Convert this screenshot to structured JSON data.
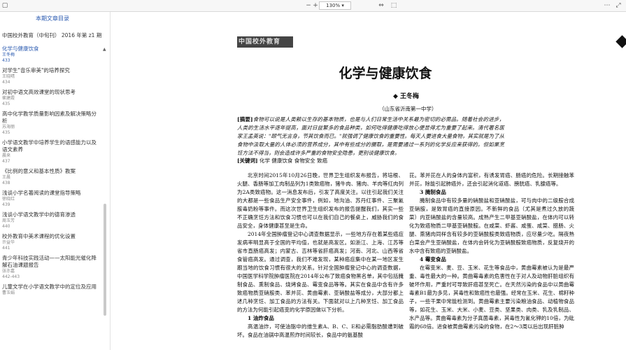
{
  "toolbar": {
    "zoom": "130%",
    "icons": [
      "page-icon",
      "close-x-icon",
      "zoom-out-icon",
      "zoom-in-icon",
      "zoom-dropdown-icon",
      "fit-width-icon",
      "fit-page-icon",
      "more-icon"
    ]
  },
  "sidebar": {
    "title": "本期文章目录",
    "journal": "中国校外教育（中旬刊）  2016 年第 z1 期",
    "items": [
      {
        "title": "化学与健康饮食",
        "author": "王冬梅",
        "page": "433",
        "active": true
      },
      {
        "title": "对学生\"音乐审美\"的培养探究",
        "author": "王晓晴",
        "page": "434"
      },
      {
        "title": "对初中语文高效课堂的现状思考",
        "author": "崔建霞",
        "page": "435"
      },
      {
        "title": "高中化学教学质量影响因素及解决策略分析",
        "author": "苏海丽",
        "page": "435"
      },
      {
        "title": "小学语文教学中培养学生的语感能力以及语文素养",
        "author": "晨来",
        "page": "437"
      },
      {
        "title": "《比例的意义和基本性质》教案",
        "author": "王晨",
        "page": "438"
      },
      {
        "title": "浅谈小学名著阅读的课堂指导策略",
        "author": "徐晓红",
        "page": "439"
      },
      {
        "title": "浅谈小学语文教学中的德育渗透",
        "author": "周玉芳",
        "page": "440"
      },
      {
        "title": "校外教育中美术课程的优化设置",
        "author": "许益华",
        "page": "441"
      },
      {
        "title": "青少年科技实践活动——太阳能光催化降解石油课题报告",
        "author": "张亦嘉",
        "page": "442-443"
      },
      {
        "title": "儿童文学在小学语文教学中的定位及应用",
        "author": "曹玉娟",
        "page": ""
      }
    ]
  },
  "doc": {
    "masthead": "中国校外教育",
    "headline": "化学与健康饮食",
    "author": "◆ 王冬梅",
    "affiliation": "（山东省沂南第一中学）",
    "abstract_label": "[摘要]",
    "abstract": "食物可以说是人类赖以生存的基本物质，也是与人们日常生活中关系最为密切的必需品。随着社会的进步，人类的生活水平逐年提高，面对日益繁多的食品种类，如何吃得健康吃得放心便显得尤为重要了起来。清代著名医家王孟英说：\"颐气无言身，节其饮食而已。\"就强调了健康饮食的重要性。每天人要进食大量食物，其实就是为了从食物中汲取大量的人体必须的营养成分，其中有些成分的摄取，是需要通过一系列的化学反应来获得的。但如果烹饪方法不得当，则会造成许多严重的食物安全隐患，更别谈健康饮食。",
    "keywords_label": "[关键词]",
    "keywords": "化学   健康饮食   食物安全   致癌",
    "col1": [
      {
        "type": "p",
        "text": "北京时间2015年10月26日晚，世界卫生组织发布报告，将培根、火腿、香肠等加工肉制品列为1类致癌物，猪牛肉、猪肉、羊肉等红肉列为2A类致癌物。这一消息发布后，引发了高度关注。以往引起我们关注的大都是一些食品生产安全事件，例如，地沟油、苏丹红事件、三聚氰胺毒奶粉等事件。而这次世界卫生组织发布的报告提醒我们，其实一些不正确烹饪方法和饮食习惯也可以在我们自己的餐桌上，威胁我们的食品安全，身体健康甚至是生命。"
      },
      {
        "type": "p",
        "text": "2014年全国肿瘤登记中心调查数据显示，一些地方存在着某些癌症发病率明显高于全国的平均值，也就是高发区。如浙江、上海、江苏等省市直肠癌高发；内蒙古、吉林等省肝癌高发；河南、河北、山西等省食管癌高发。通过调查，我们不难发现，某种癌症集中在某一地区发生跟当地的饮食习惯有很大的关系。针对全国肿瘤登记中心的调查数据，中国医学科学院肿瘤医院在2014年公布了致癌食物黑名单，其中包括腌制食品、熏制食品、烧烤食品、霉变食品等等。其实在食品中含有许多致癌物质亚硝胺类、苯并芘、黄曲霉素、亚硝酸盐等成分，大部分都上述几种烹饪、加工食品的方法有关。下面就对以上几种烹饪、加工食品的方法为何能引起癌变的化学原因做以下分析。"
      },
      {
        "type": "h",
        "text": "1 油炸食品"
      },
      {
        "type": "p",
        "text": "高温油炸，可使油脂中的维生素A、B、C、E和必需脂肪酸遭到破坏。食品在油锅中高温煎炸时间较长，食品中的氨基酸"
      }
    ],
    "col2": [
      {
        "type": "n",
        "text": "芘。苯并芘在人的身体内富积，有诱发胃癌、肠癌的危险。长期接触苯并芘，除能引起肺癌外，还会引起消化道癌、膀胱癌、乳腺癌等。"
      },
      {
        "type": "h",
        "text": "3 腌制食品"
      },
      {
        "type": "p",
        "text": "腌制食品中有较多量的硝酸盐和亚硝酸盐，可与肉中的二级胺合成亚硝胺，是致胃癌的直接原因。不新鲜的食品（尤其是煮过久放的蔬菜）内亚硝酸盐的含量较高。成熟产生二甲基亚硝酸盐，在体内可以转化为致癌物质二甲基亚硝酸胺。在咸菜、虾酱、咸蛋、咸菜、腊肠、火腿、熏猪肉同样含有较多的亚硝酸胺类致癌物质，应尽量少吃。隔夜熟白菜会产生亚硝酸盐，在体内会转化为亚硝酸胺致癌物质，反复烧开的水中含有致癌的亚硝酸盐。"
      },
      {
        "type": "h",
        "text": "4 霉变食品"
      },
      {
        "type": "p",
        "text": "在霉变米、麦、豆、玉米、花生等食品中，黄曲霉素被认为是最严重、毒性最大的一种。黄曲霉毒素的危害性在于对人及动物肝脏组织有破坏作用，严重时可导致肝癌甚至死亡。在天然污染的食品中以黄曲霉毒素B1最为多见，其毒性和致癌性也最强。经常在玉米、花生、棉籽种子，一些干果中常能检测到。黄曲霉素主要污染粮油食品、动植物食品等，如花生、玉米、大米、小麦、豆类、坚果类、肉类、乳及乳制品、水产品等。黄曲霉毒素为分子真菌毒素，其毒性为氰化钾的10倍，为砒霜的68倍。进食被黄曲霉素污染的食物，在2～3周以后出现肝脏肿"
      }
    ]
  }
}
